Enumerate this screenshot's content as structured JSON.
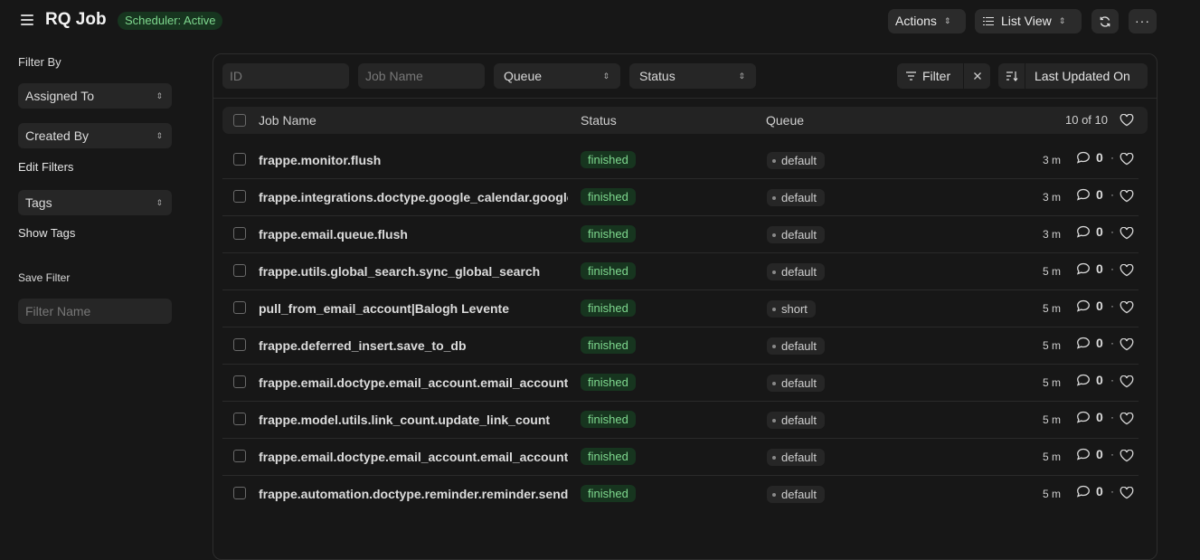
{
  "header": {
    "title": "RQ Job",
    "scheduler_badge": "Scheduler: Active",
    "actions_label": "Actions",
    "list_view_label": "List View",
    "more_label": "···"
  },
  "sidebar": {
    "filter_by_label": "Filter By",
    "assigned_to_label": "Assigned To",
    "created_by_label": "Created By",
    "edit_filters_label": "Edit Filters",
    "tags_label": "Tags",
    "show_tags_label": "Show Tags",
    "save_filter_label": "Save Filter",
    "filter_name_placeholder": "Filter Name"
  },
  "filters": {
    "id_placeholder": "ID",
    "job_name_placeholder": "Job Name",
    "queue_label": "Queue",
    "status_label": "Status",
    "filter_label": "Filter",
    "sort_label": "Last Updated On"
  },
  "table": {
    "columns": {
      "name": "Job Name",
      "status": "Status",
      "queue": "Queue"
    },
    "count": "10 of 10",
    "rows": [
      {
        "name": "frappe.monitor.flush",
        "status": "finished",
        "queue": "default",
        "time": "3 m",
        "comments": "0"
      },
      {
        "name": "frappe.integrations.doctype.google_calendar.google_calendar.sync",
        "status": "finished",
        "queue": "default",
        "time": "3 m",
        "comments": "0"
      },
      {
        "name": "frappe.email.queue.flush",
        "status": "finished",
        "queue": "default",
        "time": "3 m",
        "comments": "0"
      },
      {
        "name": "frappe.utils.global_search.sync_global_search",
        "status": "finished",
        "queue": "default",
        "time": "5 m",
        "comments": "0"
      },
      {
        "name": "pull_from_email_account|Balogh Levente",
        "status": "finished",
        "queue": "short",
        "time": "5 m",
        "comments": "0"
      },
      {
        "name": "frappe.deferred_insert.save_to_db",
        "status": "finished",
        "queue": "default",
        "time": "5 m",
        "comments": "0"
      },
      {
        "name": "frappe.email.doctype.email_account.email_account.notify_unreplied",
        "status": "finished",
        "queue": "default",
        "time": "5 m",
        "comments": "0"
      },
      {
        "name": "frappe.model.utils.link_count.update_link_count",
        "status": "finished",
        "queue": "default",
        "time": "5 m",
        "comments": "0"
      },
      {
        "name": "frappe.email.doctype.email_account.email_account.pull",
        "status": "finished",
        "queue": "default",
        "time": "5 m",
        "comments": "0"
      },
      {
        "name": "frappe.automation.doctype.reminder.reminder.send_reminders",
        "status": "finished",
        "queue": "default",
        "time": "5 m",
        "comments": "0"
      }
    ]
  },
  "colors": {
    "background": "#171717",
    "success_bg": "#17351f",
    "success_text": "#7fd98f"
  }
}
